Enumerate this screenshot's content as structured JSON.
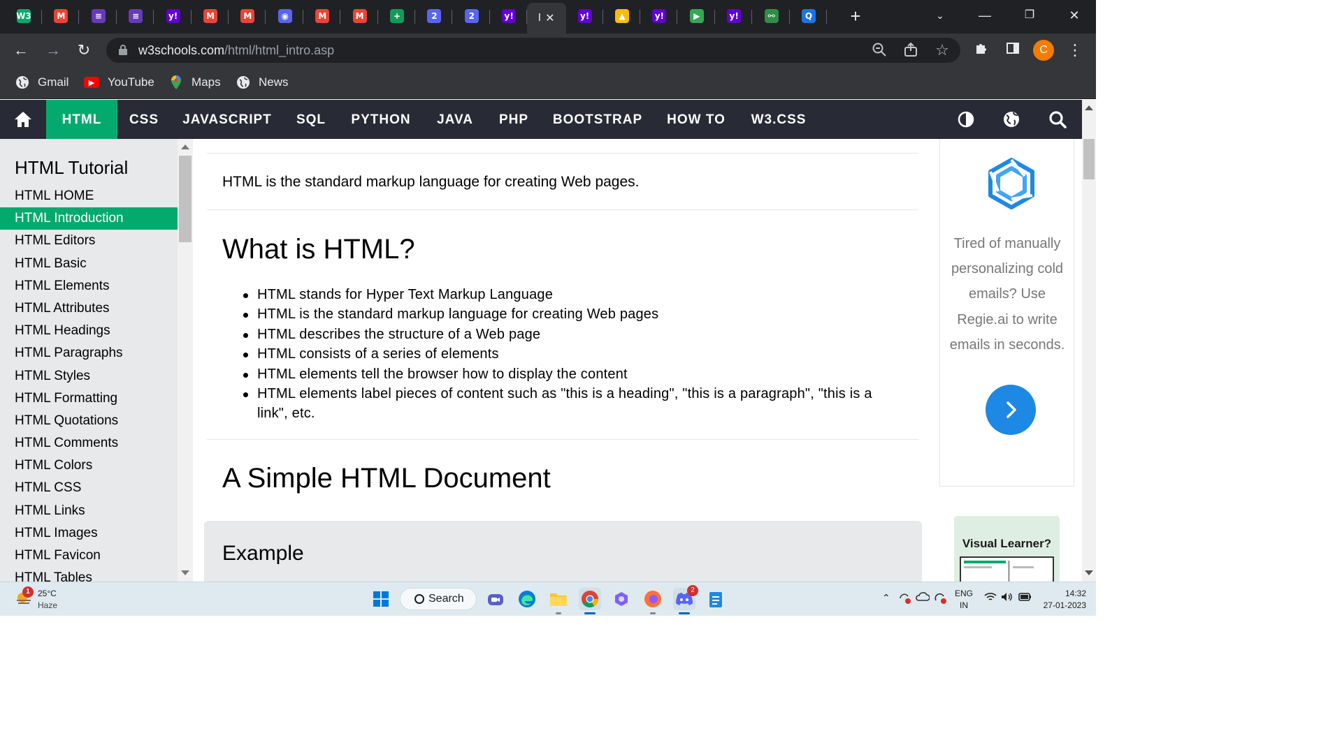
{
  "browser": {
    "tabs": [
      {
        "icon": "w3schools-favicon",
        "label": "W3",
        "color": "#04aa6d"
      },
      {
        "icon": "gmail-favicon",
        "label": "M",
        "color": "#ea4335"
      },
      {
        "icon": "forms-favicon",
        "label": "≡",
        "color": "#673ab7"
      },
      {
        "icon": "forms-favicon",
        "label": "≡",
        "color": "#673ab7"
      },
      {
        "icon": "yahoo-favicon",
        "label": "y!",
        "color": "#6001d2"
      },
      {
        "icon": "gmail-favicon",
        "label": "M",
        "color": "#ea4335"
      },
      {
        "icon": "gmail-favicon",
        "label": "M",
        "color": "#ea4335"
      },
      {
        "icon": "discord-favicon",
        "label": "◉",
        "color": "#5865f2"
      },
      {
        "icon": "gmail-favicon",
        "label": "M",
        "color": "#ea4335"
      },
      {
        "icon": "gmail-favicon",
        "label": "M",
        "color": "#ea4335"
      },
      {
        "icon": "sheets-plus-favicon",
        "label": "+",
        "color": "#0f9d58"
      },
      {
        "icon": "discord-favicon",
        "label": "2",
        "color": "#5865f2"
      },
      {
        "icon": "discord-favicon",
        "label": "2",
        "color": "#5865f2"
      },
      {
        "icon": "yahoo-favicon",
        "label": "y!",
        "color": "#6001d2"
      }
    ],
    "active_tab": {
      "label": "I",
      "close": "✕"
    },
    "tabs_after": [
      {
        "icon": "yahoo-favicon",
        "label": "y!",
        "color": "#6001d2"
      },
      {
        "icon": "drive-favicon",
        "label": "▲",
        "color": "#fbbc04"
      },
      {
        "icon": "yahoo-favicon",
        "label": "y!",
        "color": "#6001d2"
      },
      {
        "icon": "play-favicon",
        "label": "▶",
        "color": "#34a853"
      },
      {
        "icon": "yahoo-favicon",
        "label": "y!",
        "color": "#6001d2"
      },
      {
        "icon": "geeks-favicon",
        "label": "⚯",
        "color": "#2f8d46"
      },
      {
        "icon": "search-favicon",
        "label": "Q",
        "color": "#1a73e8"
      }
    ],
    "new_tab": "+",
    "url_host": "w3schools.com",
    "url_path": "/html/html_intro.asp",
    "avatar_letter": "C",
    "bookmarks": [
      {
        "icon": "globe-icon",
        "label": "Gmail"
      },
      {
        "icon": "youtube-icon",
        "label": "YouTube"
      },
      {
        "icon": "maps-icon",
        "label": "Maps"
      },
      {
        "icon": "globe-icon",
        "label": "News"
      }
    ]
  },
  "topnav": {
    "items": [
      "HTML",
      "CSS",
      "JAVASCRIPT",
      "SQL",
      "PYTHON",
      "JAVA",
      "PHP",
      "BOOTSTRAP",
      "HOW TO",
      "W3.CSS"
    ],
    "active": "HTML",
    "accent": "#04aa6d"
  },
  "sidebar": {
    "title": "HTML Tutorial",
    "items": [
      "HTML HOME",
      "HTML Introduction",
      "HTML Editors",
      "HTML Basic",
      "HTML Elements",
      "HTML Attributes",
      "HTML Headings",
      "HTML Paragraphs",
      "HTML Styles",
      "HTML Formatting",
      "HTML Quotations",
      "HTML Comments",
      "HTML Colors",
      "HTML CSS",
      "HTML Links",
      "HTML Images",
      "HTML Favicon",
      "HTML Tables"
    ],
    "active_index": 1
  },
  "main": {
    "intro": "HTML is the standard markup language for creating Web pages.",
    "what_heading": "What is HTML?",
    "bullets": [
      "HTML stands for Hyper Text Markup Language",
      "HTML is the standard markup language for creating Web pages",
      "HTML describes the structure of a Web page",
      "HTML consists of a series of elements",
      "HTML elements tell the browser how to display the content",
      "HTML elements label pieces of content such as \"this is a heading\", \"this is a paragraph\", \"this is a link\", etc."
    ],
    "simple_heading": "A Simple HTML Document",
    "example_title": "Example"
  },
  "ads": {
    "text": "Tired of manually personalizing cold emails? Use Regie.ai to write emails in seconds.",
    "second_title": "Visual Learner?"
  },
  "taskbar": {
    "weather_temp": "25°C",
    "weather_cond": "Haze",
    "weather_badge": "1",
    "search_label": "Search",
    "discord_badge": "2",
    "lang_top": "ENG",
    "lang_bottom": "IN",
    "time": "14:32",
    "date": "27-01-2023"
  }
}
